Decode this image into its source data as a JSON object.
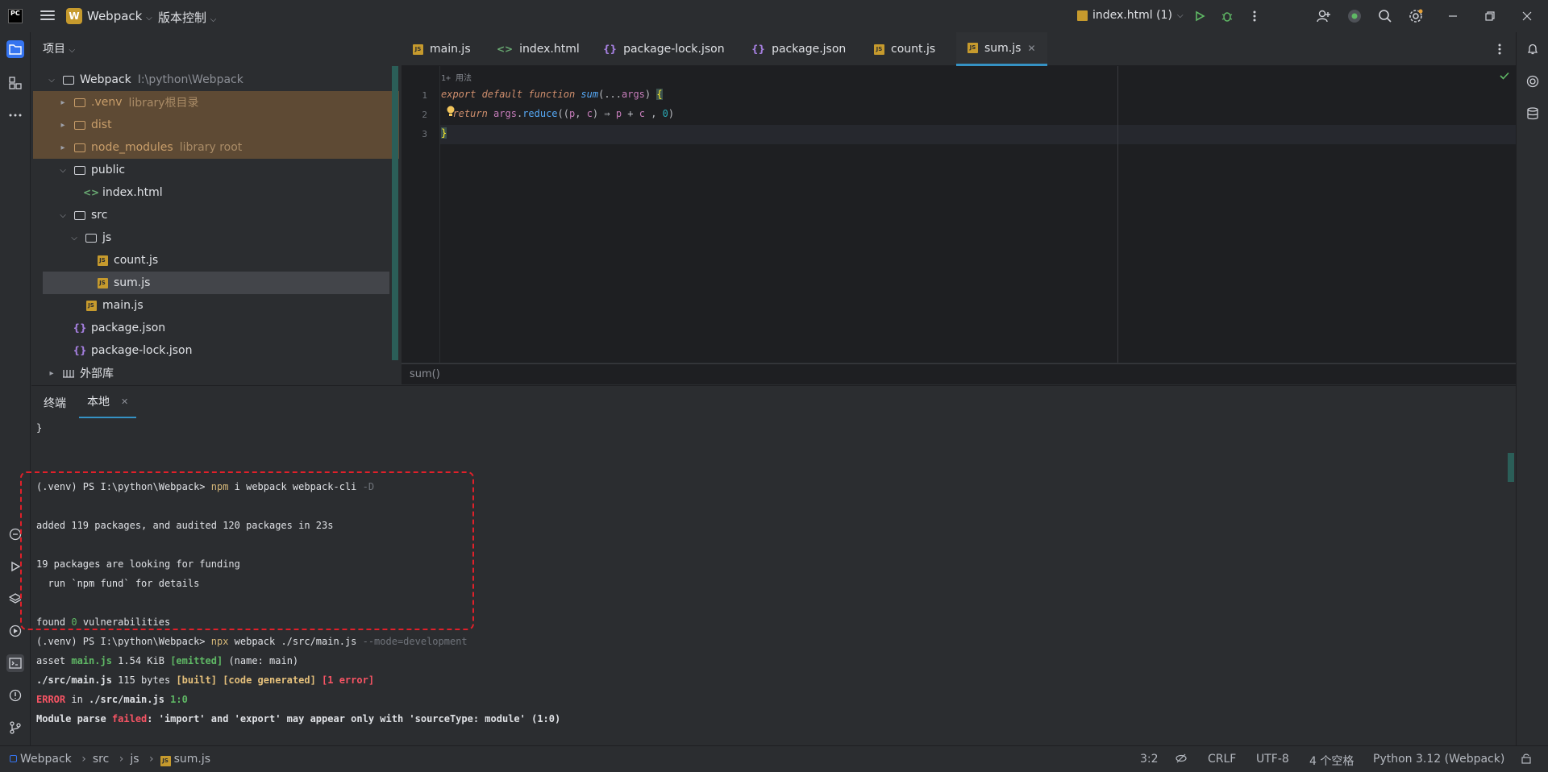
{
  "titlebar": {
    "logo_text": "PC",
    "project_badge": "W",
    "project_name": "Webpack",
    "vcs_label": "版本控制",
    "run_config": "index.html (1)"
  },
  "project_panel": {
    "title": "项目",
    "tree": [
      {
        "label": "Webpack",
        "extra": "I:\\python\\Webpack"
      },
      {
        "label": ".venv",
        "extra": "library根目录"
      },
      {
        "label": "dist",
        "extra": ""
      },
      {
        "label": "node_modules",
        "extra": "library root"
      },
      {
        "label": "public",
        "extra": ""
      },
      {
        "label": "index.html",
        "extra": ""
      },
      {
        "label": "src",
        "extra": ""
      },
      {
        "label": "js",
        "extra": ""
      },
      {
        "label": "count.js",
        "extra": ""
      },
      {
        "label": "sum.js",
        "extra": ""
      },
      {
        "label": "main.js",
        "extra": ""
      },
      {
        "label": "package.json",
        "extra": ""
      },
      {
        "label": "package-lock.json",
        "extra": ""
      },
      {
        "label": "外部库",
        "extra": ""
      }
    ]
  },
  "editor": {
    "tabs": [
      {
        "label": "main.js"
      },
      {
        "label": "index.html"
      },
      {
        "label": "package-lock.json"
      },
      {
        "label": "package.json"
      },
      {
        "label": "count.js"
      },
      {
        "label": "sum.js"
      }
    ],
    "usage_hint": "1+ 用法",
    "line_numbers": [
      "1",
      "2",
      "3"
    ],
    "breadcrumb": "sum()"
  },
  "terminal": {
    "tabs": [
      {
        "label": "终端"
      },
      {
        "label": "本地"
      }
    ],
    "first_line": "}",
    "cmd1_prompt": "(.venv) PS I:\\python\\Webpack> ",
    "cmd1_cmd": "npm",
    "cmd1_args": " i webpack webpack-cli ",
    "cmd1_flag": "-D",
    "added_line": "added 119 packages, and audited 120 packages in 23s",
    "funding_line": "19 packages are looking for funding",
    "fund_details": "  run `npm fund` for details",
    "vuln_pre": "found ",
    "vuln_num": "0",
    "vuln_post": " vulnerabilities",
    "cmd2_prompt": "(.venv) PS I:\\python\\Webpack> ",
    "cmd2_cmd": "npx",
    "cmd2_args": " webpack ./src/main.js ",
    "cmd2_flag": "--mode=development",
    "asset_pre": "asset ",
    "asset_name": "main.js",
    "asset_size": " 1.54 KiB ",
    "asset_emitted": "[emitted]",
    "asset_post": " (name: main)",
    "src_path": "./src/main.js",
    "src_size": " 115 bytes ",
    "src_built": "[built] [code generated]",
    "src_error": "[1 error]",
    "err_word": "ERROR",
    "err_in": " in ",
    "err_path": "./src/main.js",
    "err_pos": " 1:0",
    "parse_pre": "Module parse ",
    "parse_failed": "failed",
    "parse_msg": ": 'import' and 'export' may appear only with 'sourceType: module' (1:0)"
  },
  "statusbar": {
    "crumbs": [
      "Webpack",
      "src",
      "js",
      "sum.js"
    ],
    "position": "3:2",
    "line_sep": "CRLF",
    "encoding": "UTF-8",
    "indent": "4 个空格",
    "interpreter": "Python 3.12 (Webpack)"
  },
  "colors": {
    "accent": "#3574f0",
    "excluded_bg": "#5e4a34",
    "annotation_box": "#e0202a"
  }
}
